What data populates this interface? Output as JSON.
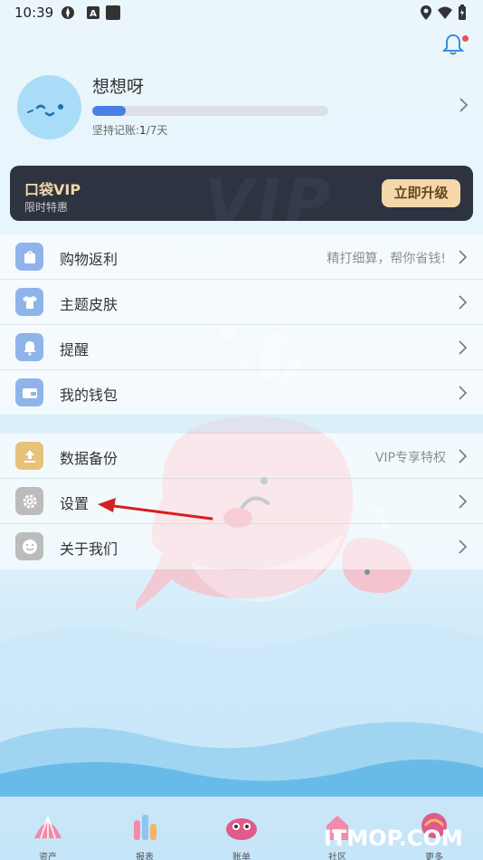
{
  "status_bar": {
    "time": "10:39"
  },
  "profile": {
    "name": "想想呀",
    "progress_fraction": 0.14,
    "streak_label": "坚持记账:",
    "streak_value": "1",
    "streak_unit": "/7天"
  },
  "vip": {
    "title": "口袋VIP",
    "subtitle": "限时特惠",
    "upgrade_label": "立即升级",
    "bg_text": "VIP"
  },
  "menu_group_1": [
    {
      "label": "购物返利",
      "right": "精打细算，帮你省钱!",
      "icon": "shopping-bag-icon",
      "color": "#8fb4ea"
    },
    {
      "label": "主题皮肤",
      "right": "",
      "icon": "shirt-icon",
      "color": "#8fb4ea"
    },
    {
      "label": "提醒",
      "right": "",
      "icon": "bell-icon",
      "color": "#8fb4ea"
    },
    {
      "label": "我的钱包",
      "right": "",
      "icon": "wallet-icon",
      "color": "#8fb4ea"
    }
  ],
  "menu_group_2": [
    {
      "label": "数据备份",
      "right": "VIP专享特权",
      "icon": "upload-icon",
      "color": "#e6c27c"
    },
    {
      "label": "设置",
      "right": "",
      "icon": "gear-icon",
      "color": "#bcbcbc"
    },
    {
      "label": "关于我们",
      "right": "",
      "icon": "smiley-icon",
      "color": "#bcbcbc"
    }
  ],
  "tabs": [
    {
      "label": "资产",
      "icon": "shell-icon"
    },
    {
      "label": "报表",
      "icon": "coral-icon"
    },
    {
      "label": "账单",
      "icon": "whale-icon"
    },
    {
      "label": "社区",
      "icon": "house-icon"
    },
    {
      "label": "更多",
      "icon": "balloon-icon"
    }
  ],
  "watermark": "ITMOP.COM",
  "colors": {
    "accent": "#4a7fe6",
    "vip_bg": "#2d3341",
    "vip_gold": "#f4d8a9"
  }
}
